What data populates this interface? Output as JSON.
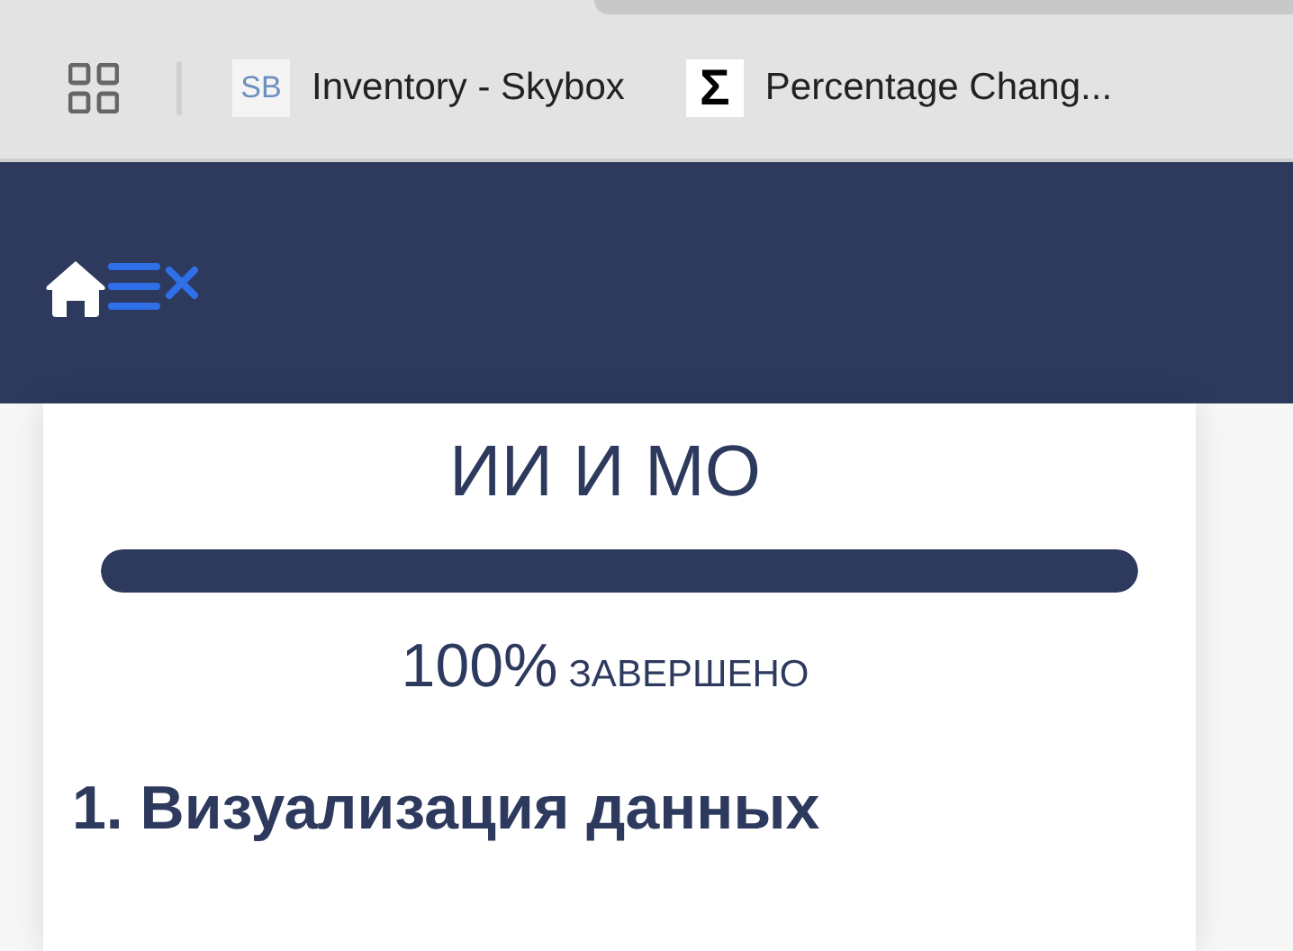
{
  "bookmarks_bar": {
    "items": [
      {
        "favicon": "SB",
        "label": "Inventory - Skybox"
      },
      {
        "favicon": "Σ",
        "label": "Percentage Chang..."
      }
    ]
  },
  "course": {
    "title": "ИИ И МО",
    "progress": {
      "level": 1.0,
      "percent": "100%",
      "label": "ЗАВЕРШЕНО"
    },
    "section_heading": "1. Визуализация данных"
  }
}
